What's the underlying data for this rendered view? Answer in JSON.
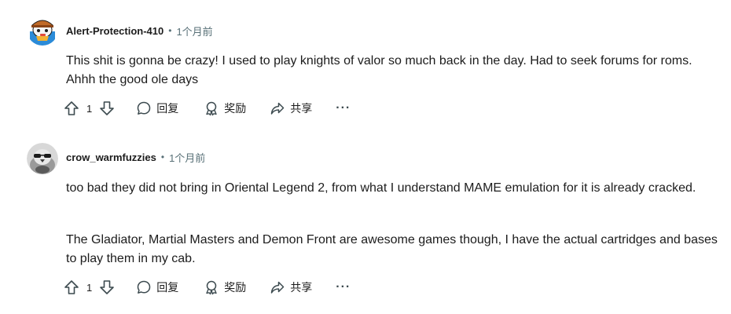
{
  "comments": [
    {
      "author": "Alert-Protection-410",
      "separator": "•",
      "time": "1个月前",
      "paragraphs": [
        "This shit is gonna be crazy! I used to play knights of valor so much back in the day. Had to seek forums for roms. Ahhh the good ole days"
      ],
      "votes": "1",
      "reply_label": "回复",
      "award_label": "奖励",
      "share_label": "共享",
      "more_label": "···"
    },
    {
      "author": "crow_warmfuzzies",
      "separator": "•",
      "time": "1个月前",
      "paragraphs": [
        "too bad they did not bring in Oriental Legend 2, from what I understand MAME emulation for it is already cracked.",
        "The Gladiator, Martial Masters and Demon Front are awesome games though, I have the actual cartridges and bases to play them in my cab."
      ],
      "votes": "1",
      "reply_label": "回复",
      "award_label": "奖励",
      "share_label": "共享",
      "more_label": "···"
    }
  ],
  "icons": {
    "upvote": "upvote-arrow-icon",
    "downvote": "downvote-arrow-icon",
    "reply": "speech-bubble-icon",
    "award": "award-ribbon-icon",
    "share": "share-arrow-icon",
    "more": "ellipsis-icon"
  },
  "colors": {
    "text": "#1c1c1c",
    "meta": "#576f76",
    "icon": "#3c4a4f"
  }
}
